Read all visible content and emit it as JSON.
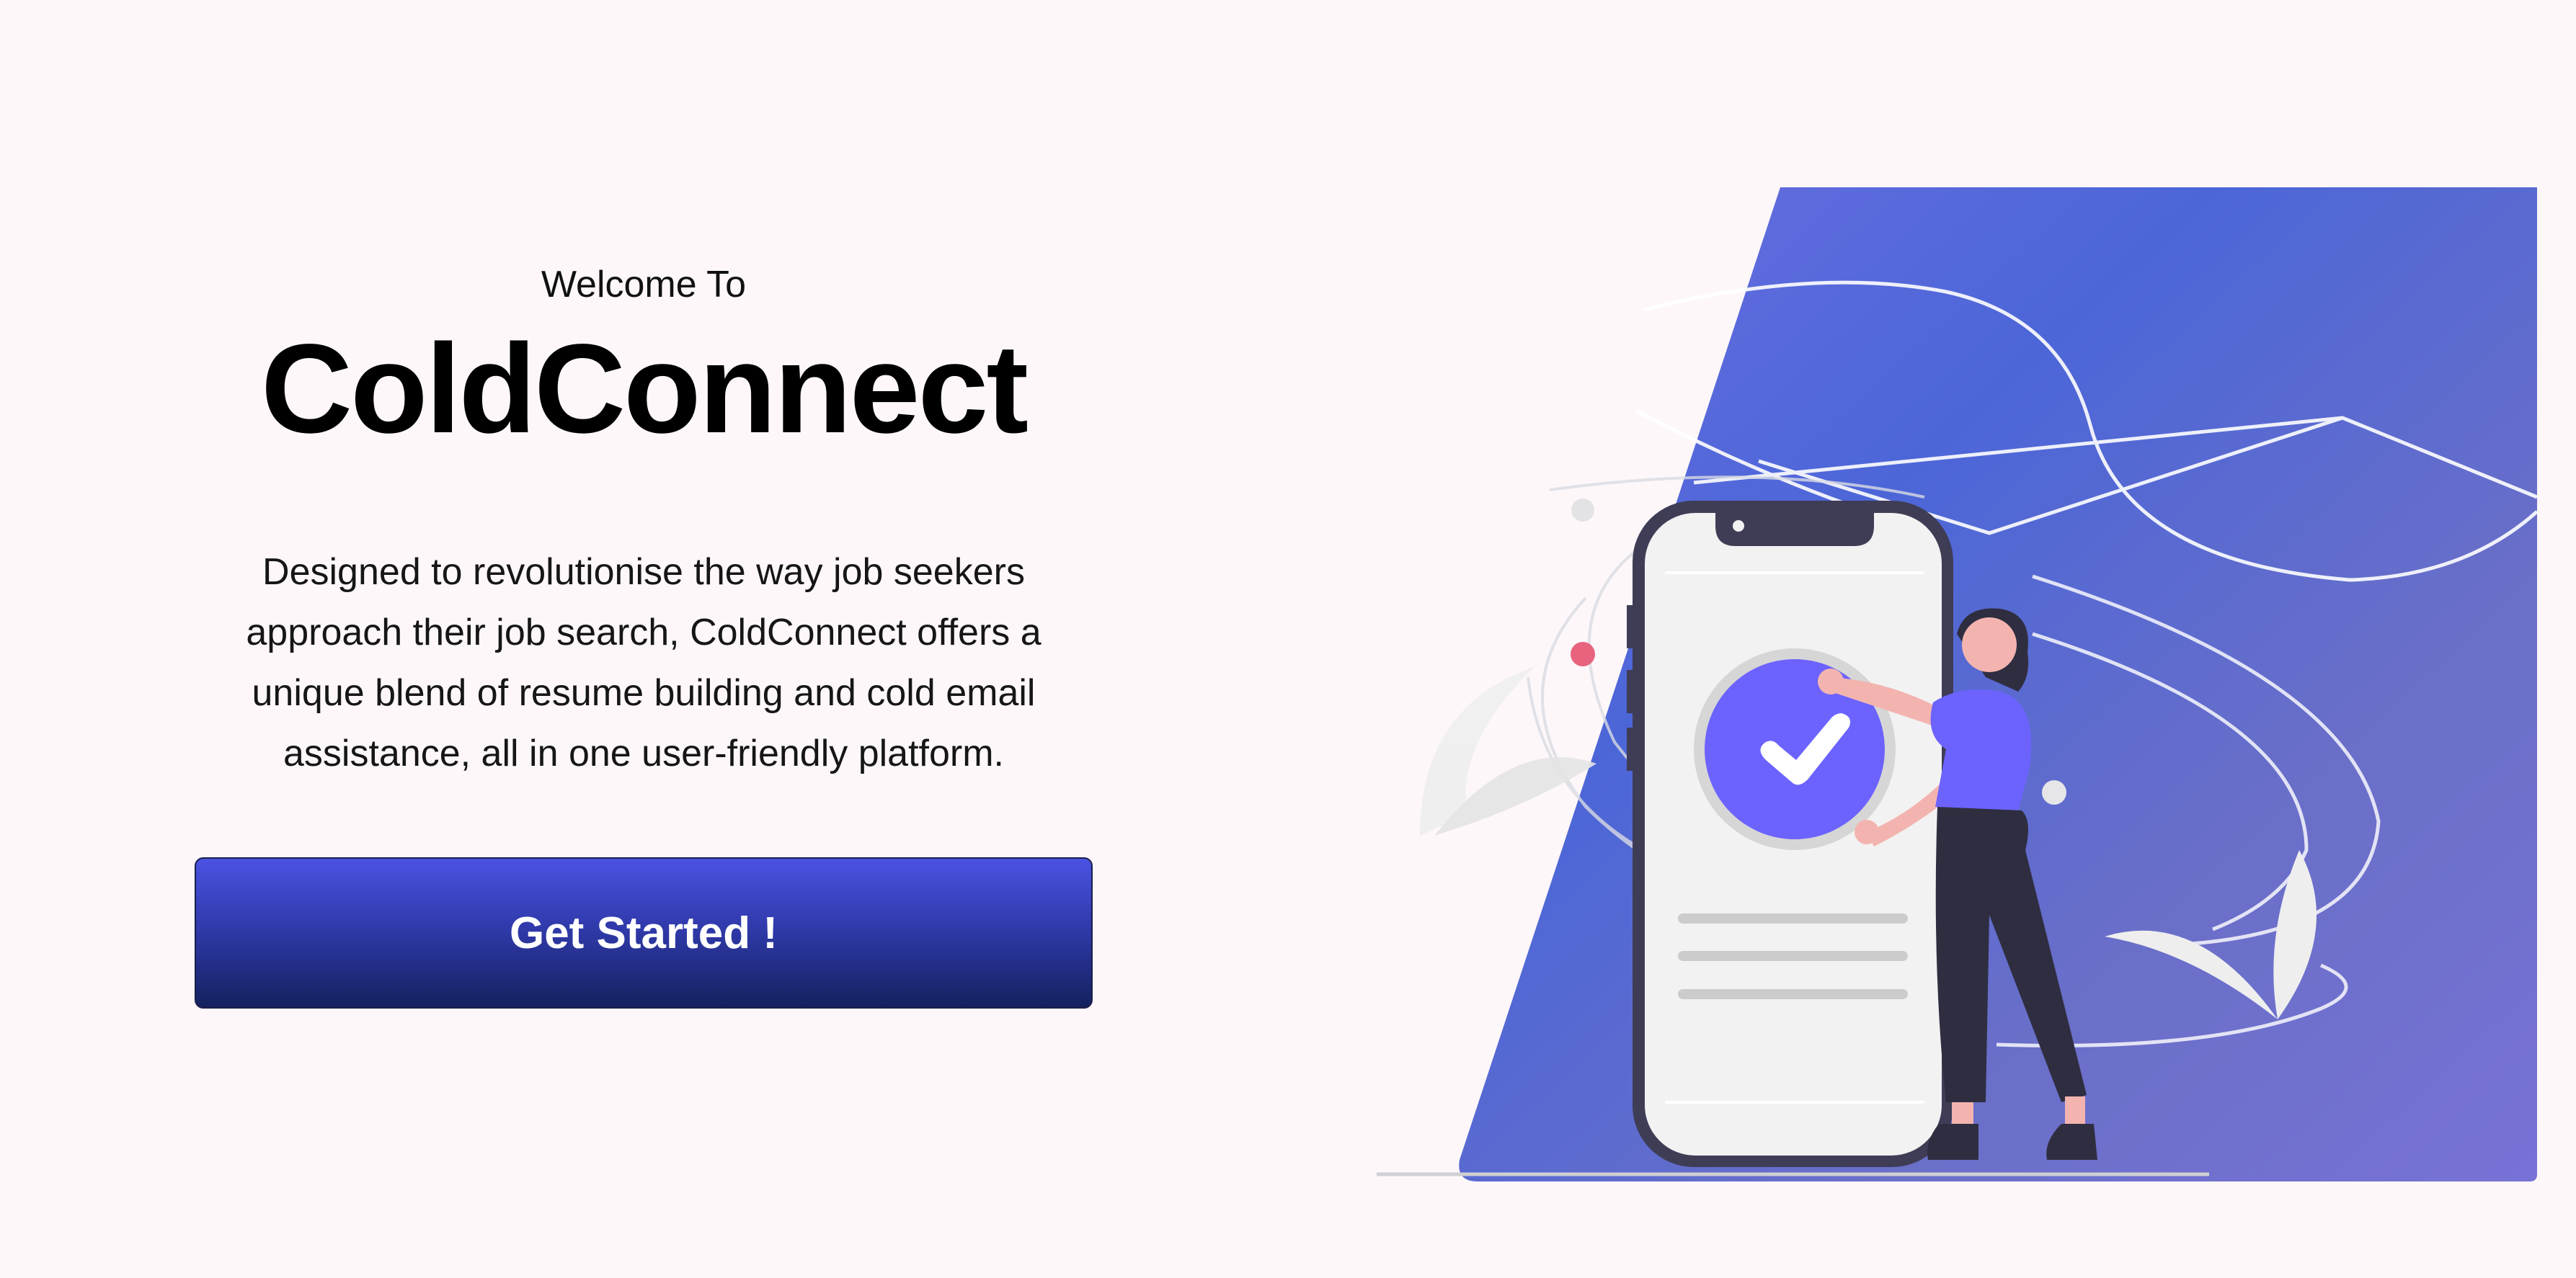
{
  "hero": {
    "welcome": "Welcome To",
    "title": "ColdConnect",
    "description": "Designed to revolutionise the way job seekers approach their job search, ColdConnect offers a unique blend of resume building and cold email assistance, all in one user-friendly platform.",
    "cta_label": "Get Started !"
  },
  "colors": {
    "page_background": "#fdf7fa",
    "accent": "#6c63ff",
    "button_top": "#4b52e2",
    "button_bottom": "#14225e"
  },
  "illustration": {
    "icons": [
      "phone-icon",
      "checkmark-icon",
      "woman-figure",
      "leaf-icon"
    ]
  }
}
